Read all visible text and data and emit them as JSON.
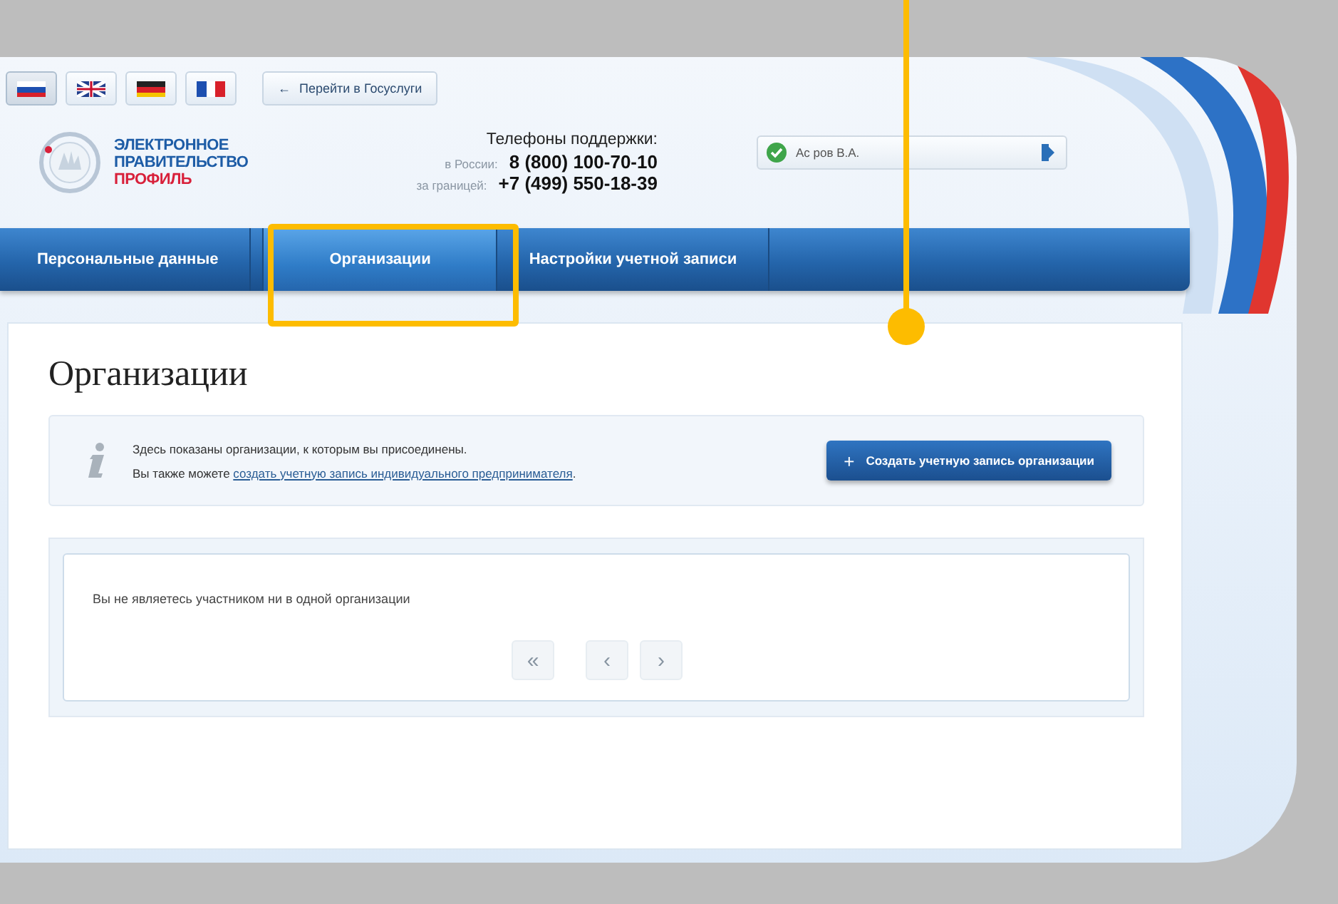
{
  "languages": [
    {
      "kind": "ru",
      "selected": true
    },
    {
      "kind": "uk",
      "selected": false
    },
    {
      "kind": "de",
      "selected": false
    },
    {
      "kind": "fr",
      "selected": false
    }
  ],
  "gosuslugi_link": {
    "arrow": "←",
    "label": "Перейти в Госуслуги"
  },
  "logo": {
    "line_1": "ЭЛЕКТРОННОЕ",
    "line_2": "ПРАВИТЕЛЬСТВО",
    "line_3": "ПРОФИЛЬ"
  },
  "support": {
    "title": "Телефоны поддержки:",
    "phones": [
      {
        "label": "в России:",
        "number": "8 (800) 100-70-10"
      },
      {
        "label": "за границей:",
        "number": "+7 (499) 550-18-39"
      }
    ]
  },
  "user": {
    "name": "Ас ров В.А."
  },
  "tabs": [
    {
      "label": "Персональные данные",
      "selected": false
    },
    {
      "label": "Организации",
      "selected": true
    },
    {
      "label": "Настройки учетной записи",
      "selected": false
    }
  ],
  "page_title": "Организации",
  "info": {
    "line_1": "Здесь показаны организации, к которым вы присоединены.",
    "line_2_prefix": "Вы также можете ",
    "line_2_link": "создать учетную запись индивидуального предпринимателя",
    "line_2_suffix": "."
  },
  "create_button": {
    "icon": "+",
    "label": "Создать учетную запись организации"
  },
  "empty_message": "Вы не являетесь участником ни в одной организации",
  "pagination": [
    {
      "label": "«",
      "disabled": true
    },
    {
      "label": "‹",
      "disabled": true
    },
    {
      "label": "›",
      "disabled": true
    }
  ]
}
